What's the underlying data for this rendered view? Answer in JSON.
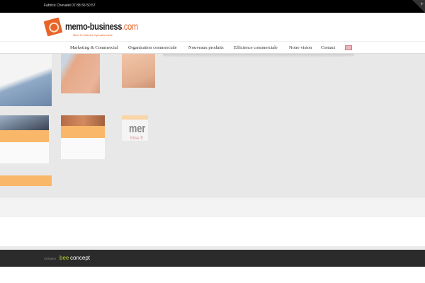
{
  "topbar": {
    "contact": "Fabrice Chevalet 07 88 56 50 57",
    "toggle": "+"
  },
  "logo": {
    "name": "memo-business",
    "tld": ".com",
    "tagline": "Mise En Marché Opérationnelle"
  },
  "nav": {
    "items": [
      "Marketing & Commercial",
      "Organisation commerciale",
      "Nouveaux produits",
      "Efficience commerciale",
      "Notre vision",
      "Contact"
    ]
  },
  "slider": {
    "tile_text": "mer",
    "tile_subtext": "Mise E"
  },
  "footer": {
    "credit_label": "Création",
    "brand_part1": "bee",
    "brand_part2": "concept"
  },
  "colors": {
    "accent": "#f9b76a",
    "logo_orange": "#e8642a",
    "footer_bg": "#2b2b2b"
  }
}
